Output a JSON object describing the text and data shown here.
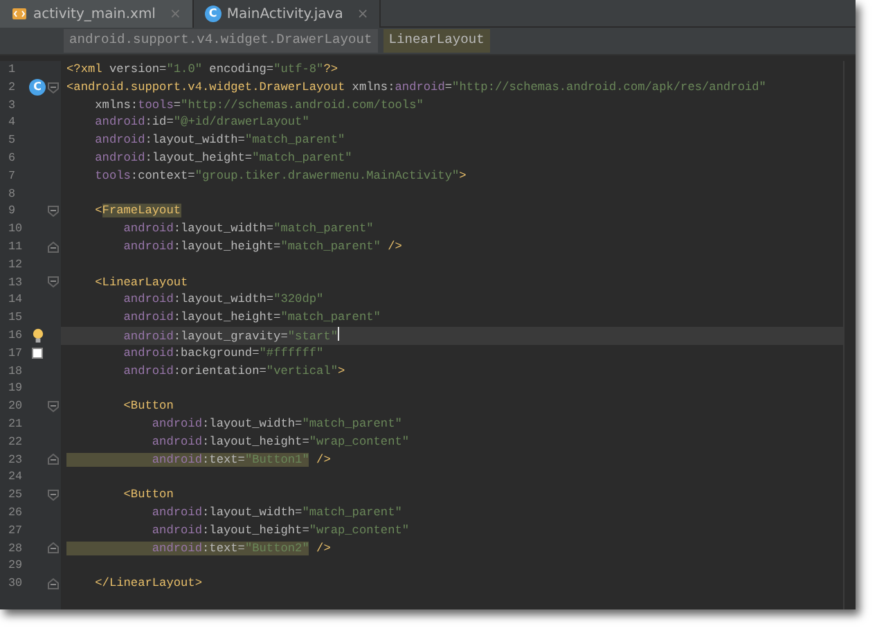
{
  "tabs": [
    {
      "label": "activity_main.xml",
      "kind": "xml",
      "selected": true,
      "close": "×"
    },
    {
      "label": "MainActivity.java",
      "kind": "class",
      "icon_text": "C",
      "selected": false,
      "close": "×"
    }
  ],
  "breadcrumbs": [
    {
      "label": "android.support.v4.widget.DrawerLayout",
      "selected": false
    },
    {
      "label": "LinearLayout",
      "selected": true
    }
  ],
  "lines": [
    {
      "number": "1",
      "current": false,
      "segments": [
        {
          "kind": "tag",
          "t": "<?xml",
          "hl": false
        },
        {
          "kind": "attr",
          "t": " version=",
          "hl": false
        },
        {
          "kind": "str",
          "t": "\"1.0\"",
          "hl": false
        },
        {
          "kind": "attr",
          "t": " encoding=",
          "hl": false
        },
        {
          "kind": "str",
          "t": "\"utf-8\"",
          "hl": false
        },
        {
          "kind": "tag",
          "t": "?>",
          "hl": false
        }
      ]
    },
    {
      "number": "2",
      "current": false,
      "fold": {
        "kind": "open"
      },
      "gutter_icon": {
        "kind": "class",
        "text": "C"
      },
      "segments": [
        {
          "kind": "tag",
          "t": "<android.support.v4.widget.DrawerLayout",
          "hl": false
        },
        {
          "kind": "attr",
          "t": " xmlns:",
          "hl": false
        },
        {
          "kind": "ns",
          "t": "android",
          "hl": false
        },
        {
          "kind": "attr",
          "t": "=",
          "hl": false
        },
        {
          "kind": "str",
          "t": "\"http://schemas.android.com/apk/res/android\"",
          "hl": false
        }
      ]
    },
    {
      "number": "3",
      "current": false,
      "segments": [
        {
          "kind": "attr",
          "t": "    xmlns:",
          "hl": false
        },
        {
          "kind": "ns",
          "t": "tools",
          "hl": false
        },
        {
          "kind": "attr",
          "t": "=",
          "hl": false
        },
        {
          "kind": "str",
          "t": "\"http://schemas.android.com/tools\"",
          "hl": false
        }
      ]
    },
    {
      "number": "4",
      "current": false,
      "segments": [
        {
          "kind": "ns",
          "t": "    android",
          "hl": false
        },
        {
          "kind": "attr",
          "t": ":id=",
          "hl": false
        },
        {
          "kind": "str",
          "t": "\"@+id/drawerLayout\"",
          "hl": false
        }
      ]
    },
    {
      "number": "5",
      "current": false,
      "segments": [
        {
          "kind": "ns",
          "t": "    android",
          "hl": false
        },
        {
          "kind": "attr",
          "t": ":layout_width=",
          "hl": false
        },
        {
          "kind": "str",
          "t": "\"match_parent\"",
          "hl": false
        }
      ]
    },
    {
      "number": "6",
      "current": false,
      "segments": [
        {
          "kind": "ns",
          "t": "    android",
          "hl": false
        },
        {
          "kind": "attr",
          "t": ":layout_height=",
          "hl": false
        },
        {
          "kind": "str",
          "t": "\"match_parent\"",
          "hl": false
        }
      ]
    },
    {
      "number": "7",
      "current": false,
      "segments": [
        {
          "kind": "ns",
          "t": "    tools",
          "hl": false
        },
        {
          "kind": "attr",
          "t": ":context=",
          "hl": false
        },
        {
          "kind": "str",
          "t": "\"group.tiker.drawermenu.MainActivity\"",
          "hl": false
        },
        {
          "kind": "tag",
          "t": ">",
          "hl": false
        }
      ]
    },
    {
      "number": "8",
      "current": false
    },
    {
      "number": "9",
      "current": false,
      "fold": {
        "kind": "open"
      },
      "segments": [
        {
          "kind": "tag",
          "t": "    <",
          "hl": false
        },
        {
          "kind": "tag",
          "t": "FrameLayout",
          "hl": true
        }
      ]
    },
    {
      "number": "10",
      "current": false,
      "segments": [
        {
          "kind": "ns",
          "t": "        android",
          "hl": false
        },
        {
          "kind": "attr",
          "t": ":layout_width=",
          "hl": false
        },
        {
          "kind": "str",
          "t": "\"match_parent\"",
          "hl": false
        }
      ]
    },
    {
      "number": "11",
      "current": false,
      "fold": {
        "kind": "close"
      },
      "segments": [
        {
          "kind": "ns",
          "t": "        android",
          "hl": false
        },
        {
          "kind": "attr",
          "t": ":layout_height=",
          "hl": false
        },
        {
          "kind": "str",
          "t": "\"match_parent\"",
          "hl": false
        },
        {
          "kind": "tag",
          "t": " />",
          "hl": false
        }
      ]
    },
    {
      "number": "12",
      "current": false
    },
    {
      "number": "13",
      "current": false,
      "fold": {
        "kind": "open"
      },
      "segments": [
        {
          "kind": "tag",
          "t": "    <LinearLayout",
          "hl": false
        }
      ]
    },
    {
      "number": "14",
      "current": false,
      "segments": [
        {
          "kind": "ns",
          "t": "        android",
          "hl": false
        },
        {
          "kind": "attr",
          "t": ":layout_width=",
          "hl": false
        },
        {
          "kind": "str",
          "t": "\"320dp\"",
          "hl": false
        }
      ]
    },
    {
      "number": "15",
      "current": false,
      "segments": [
        {
          "kind": "ns",
          "t": "        android",
          "hl": false
        },
        {
          "kind": "attr",
          "t": ":layout_height=",
          "hl": false
        },
        {
          "kind": "str",
          "t": "\"match_parent\"",
          "hl": false
        }
      ]
    },
    {
      "number": "16",
      "current": true,
      "gutter_icon": {
        "kind": "bulb"
      },
      "segments": [
        {
          "kind": "ns",
          "t": "        android",
          "hl": false
        },
        {
          "kind": "attr",
          "t": ":layout_gravity=",
          "hl": false
        },
        {
          "kind": "str",
          "t": "\"start\"",
          "hl": false
        }
      ]
    },
    {
      "number": "17",
      "current": false,
      "gutter_icon": {
        "kind": "swatch",
        "color": "#ffffff"
      },
      "segments": [
        {
          "kind": "ns",
          "t": "        android",
          "hl": false
        },
        {
          "kind": "attr",
          "t": ":background=",
          "hl": false
        },
        {
          "kind": "str",
          "t": "\"#ffffff\"",
          "hl": false
        }
      ]
    },
    {
      "number": "18",
      "current": false,
      "segments": [
        {
          "kind": "ns",
          "t": "        android",
          "hl": false
        },
        {
          "kind": "attr",
          "t": ":orientation=",
          "hl": false
        },
        {
          "kind": "str",
          "t": "\"vertical\"",
          "hl": false
        },
        {
          "kind": "tag",
          "t": ">",
          "hl": false
        }
      ]
    },
    {
      "number": "19",
      "current": false
    },
    {
      "number": "20",
      "current": false,
      "fold": {
        "kind": "open"
      },
      "segments": [
        {
          "kind": "tag",
          "t": "        <Button",
          "hl": false
        }
      ]
    },
    {
      "number": "21",
      "current": false,
      "segments": [
        {
          "kind": "ns",
          "t": "            android",
          "hl": false
        },
        {
          "kind": "attr",
          "t": ":layout_width=",
          "hl": false
        },
        {
          "kind": "str",
          "t": "\"match_parent\"",
          "hl": false
        }
      ]
    },
    {
      "number": "22",
      "current": false,
      "segments": [
        {
          "kind": "ns",
          "t": "            android",
          "hl": false
        },
        {
          "kind": "attr",
          "t": ":layout_height=",
          "hl": false
        },
        {
          "kind": "str",
          "t": "\"wrap_content\"",
          "hl": false
        }
      ]
    },
    {
      "number": "23",
      "current": false,
      "fold": {
        "kind": "close"
      },
      "segments": [
        {
          "kind": "ns",
          "t": "            android",
          "hl": true
        },
        {
          "kind": "attr",
          "t": ":text=",
          "hl": true
        },
        {
          "kind": "str",
          "t": "\"Button1\"",
          "hl": true
        },
        {
          "kind": "tag",
          "t": " />",
          "hl": false
        }
      ]
    },
    {
      "number": "24",
      "current": false
    },
    {
      "number": "25",
      "current": false,
      "fold": {
        "kind": "open"
      },
      "segments": [
        {
          "kind": "tag",
          "t": "        <Button",
          "hl": false
        }
      ]
    },
    {
      "number": "26",
      "current": false,
      "segments": [
        {
          "kind": "ns",
          "t": "            android",
          "hl": false
        },
        {
          "kind": "attr",
          "t": ":layout_width=",
          "hl": false
        },
        {
          "kind": "str",
          "t": "\"match_parent\"",
          "hl": false
        }
      ]
    },
    {
      "number": "27",
      "current": false,
      "segments": [
        {
          "kind": "ns",
          "t": "            android",
          "hl": false
        },
        {
          "kind": "attr",
          "t": ":layout_height=",
          "hl": false
        },
        {
          "kind": "str",
          "t": "\"wrap_content\"",
          "hl": false
        }
      ]
    },
    {
      "number": "28",
      "current": false,
      "fold": {
        "kind": "close"
      },
      "segments": [
        {
          "kind": "ns",
          "t": "            android",
          "hl": true
        },
        {
          "kind": "attr",
          "t": ":text=",
          "hl": true
        },
        {
          "kind": "str",
          "t": "\"Button2\"",
          "hl": true
        },
        {
          "kind": "tag",
          "t": " />",
          "hl": false
        }
      ]
    },
    {
      "number": "29",
      "current": false
    },
    {
      "number": "30",
      "current": false,
      "fold": {
        "kind": "close"
      },
      "segments": [
        {
          "kind": "tag",
          "t": "    </LinearLayout>",
          "hl": false
        }
      ]
    }
  ]
}
